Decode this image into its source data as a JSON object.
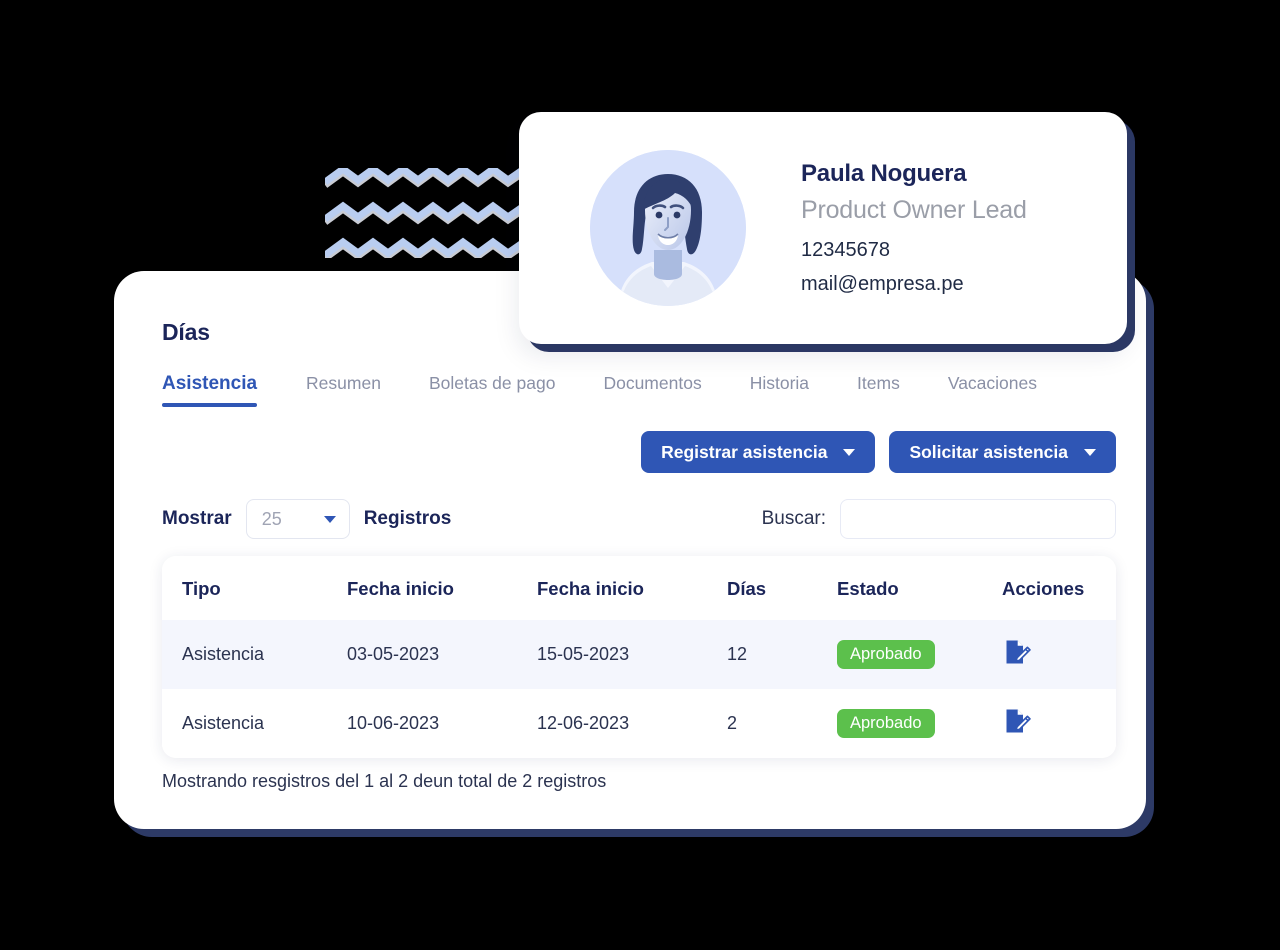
{
  "page": {
    "title": "Días"
  },
  "tabs": [
    {
      "label": "Asistencia",
      "active": true
    },
    {
      "label": "Resumen",
      "active": false
    },
    {
      "label": "Boletas de pago",
      "active": false
    },
    {
      "label": "Documentos",
      "active": false
    },
    {
      "label": "Historia",
      "active": false
    },
    {
      "label": "Items",
      "active": false
    },
    {
      "label": "Vacaciones",
      "active": false
    }
  ],
  "actions": {
    "register_label": "Registrar asistencia",
    "request_label": "Solicitar asistencia",
    "caret_icon": "chevron-down-icon"
  },
  "controls": {
    "show_label": "Mostrar",
    "records_label": "Registros",
    "page_size_value": "25",
    "page_size_options": [
      "25"
    ],
    "search_label": "Buscar:",
    "search_value": "",
    "search_placeholder": ""
  },
  "table": {
    "columns": [
      "Tipo",
      "Fecha inicio",
      "Fecha inicio",
      "Días",
      "Estado",
      "Acciones"
    ],
    "rows": [
      {
        "tipo": "Asistencia",
        "fecha_inicio": "03-05-2023",
        "fecha_fin": "15-05-2023",
        "dias": "12",
        "estado": "Aprobado",
        "action_icon": "document-edit-icon"
      },
      {
        "tipo": "Asistencia",
        "fecha_inicio": "10-06-2023",
        "fecha_fin": "12-06-2023",
        "dias": "2",
        "estado": "Aprobado",
        "action_icon": "document-edit-icon"
      }
    ]
  },
  "footer": {
    "summary": "Mostrando resgistros del 1 al 2 deun total de 2 registros"
  },
  "profile": {
    "name": "Paula Noguera",
    "role": "Product Owner Lead",
    "document": "12345678",
    "email": "mail@empresa.pe",
    "avatar_icon": "user-portrait-avatar"
  },
  "decoration": {
    "zigzag_icon": "zigzag-lines-decoration",
    "zigzag_color": "#b9cdf0",
    "zigzag_shadow_color": "#c9ccd4"
  },
  "colors": {
    "accent": "#2f56b5",
    "card_shadow_navy": "#2d3a66",
    "badge_green": "#5cc04c",
    "row_alt": "#f4f6fd",
    "heading": "#1b2559",
    "muted": "#8a90a6",
    "avatar_bg": "#d6e0fb"
  }
}
